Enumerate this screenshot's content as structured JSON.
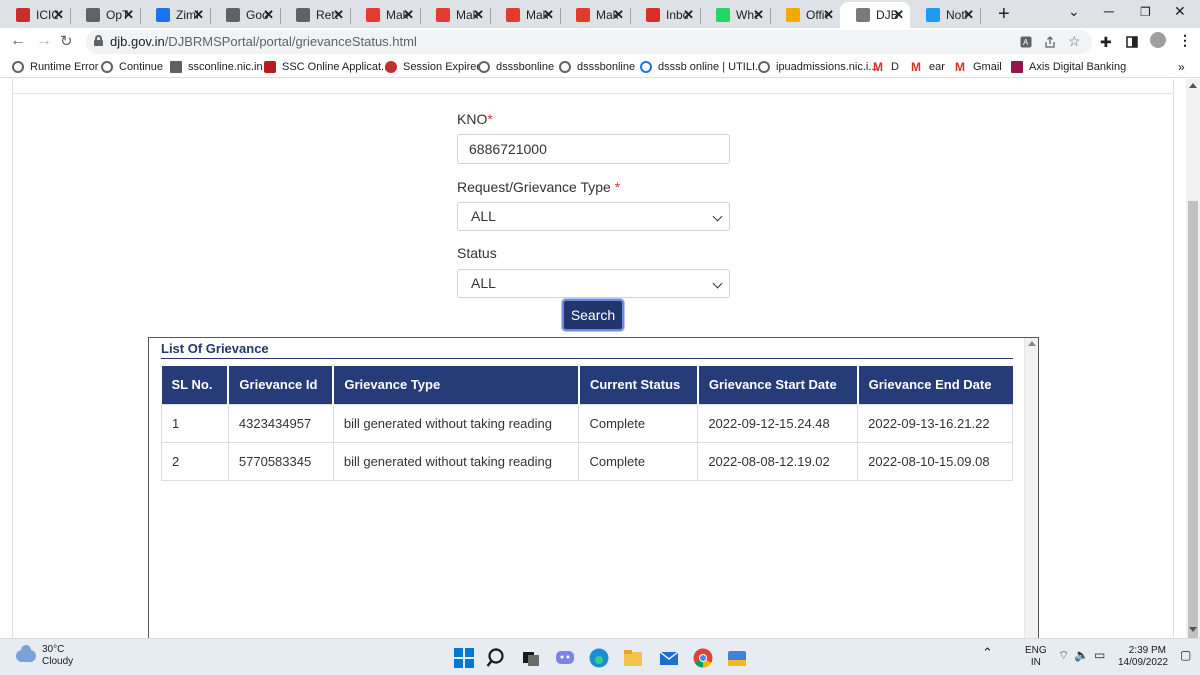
{
  "browser": {
    "tabs": [
      {
        "title": "ICICI",
        "icon": "icici-icon",
        "color": "#c72e2e"
      },
      {
        "title": "OpTi",
        "icon": "globe-icon",
        "color": "#5f6368"
      },
      {
        "title": "Zimb",
        "icon": "zimbra-icon",
        "color": "#1a73e8"
      },
      {
        "title": "Goo",
        "icon": "google-docs-icon",
        "color": "#5f6368"
      },
      {
        "title": "Reta",
        "icon": "globe-icon",
        "color": "#5f6368"
      },
      {
        "title": "Mak",
        "icon": "makemytrip-icon",
        "color": "#e33b2e"
      },
      {
        "title": "Mak",
        "icon": "makemytrip-icon",
        "color": "#e33b2e"
      },
      {
        "title": "Mak",
        "icon": "makemytrip-icon",
        "color": "#e33b2e"
      },
      {
        "title": "Mak",
        "icon": "makemytrip-icon",
        "color": "#e33b2e"
      },
      {
        "title": "Inbo",
        "icon": "gmail-icon",
        "color": "#d93025"
      },
      {
        "title": "Wha",
        "icon": "whatsapp-icon",
        "color": "#25d366"
      },
      {
        "title": "Offic",
        "icon": "office-icon",
        "color": "#f2a900"
      },
      {
        "title": "DJB",
        "icon": "djb-icon",
        "color": "#7a7a7a"
      },
      {
        "title": "Noti",
        "icon": "twitter-icon",
        "color": "#1d9bf0"
      }
    ],
    "active_tab_index": 12,
    "url_host": "djb.gov.in",
    "url_path": "/DJBRMSPortal/portal/grievanceStatus.html",
    "bookmarks": [
      {
        "label": "Runtime Error",
        "icon": "globe-icon"
      },
      {
        "label": "Continue",
        "icon": "globe-icon"
      },
      {
        "label": "ssconline.nic.in",
        "icon": "site-icon"
      },
      {
        "label": "SSC Online Applicat...",
        "icon": "ssc-icon"
      },
      {
        "label": "Session Expired",
        "icon": "icici-icon"
      },
      {
        "label": "dsssbonline",
        "icon": "globe-icon"
      },
      {
        "label": "dsssbonline",
        "icon": "globe-icon"
      },
      {
        "label": "dsssb online | UTILI...",
        "icon": "search-icon"
      },
      {
        "label": "ipuadmissions.nic.i...",
        "icon": "globe-icon"
      },
      {
        "label": "D",
        "icon": "gmail-icon"
      },
      {
        "label": "ear",
        "icon": "gmail-icon"
      },
      {
        "label": "Gmail",
        "icon": "gmail-icon"
      },
      {
        "label": "Axis Digital Banking",
        "icon": "axis-icon"
      }
    ],
    "bookmarks_overflow": "»"
  },
  "form": {
    "kno_label": "KNO",
    "kno_required": "*",
    "kno_value": "6886721000",
    "type_label": "Request/Grievance Type",
    "type_required": "*",
    "type_value": "ALL",
    "status_label": "Status",
    "status_value": "ALL",
    "search_label": "Search"
  },
  "grievance_list": {
    "title": "List Of Grievance",
    "columns": [
      "SL No.",
      "Grievance Id",
      "Grievance Type",
      "Current Status",
      "Grievance Start Date",
      "Grievance End Date"
    ],
    "rows": [
      [
        "1",
        "4323434957",
        "bill generated without taking reading",
        "Complete",
        "2022-09-12-15.24.48",
        "2022-09-13-16.21.22"
      ],
      [
        "2",
        "5770583345",
        "bill generated without taking reading",
        "Complete",
        "2022-08-08-12.19.02",
        "2022-08-10-15.09.08"
      ]
    ]
  },
  "taskbar": {
    "temperature": "30°C",
    "weather": "Cloudy",
    "lang_line1": "ENG",
    "lang_line2": "IN",
    "time": "2:39 PM",
    "date": "14/09/2022"
  }
}
